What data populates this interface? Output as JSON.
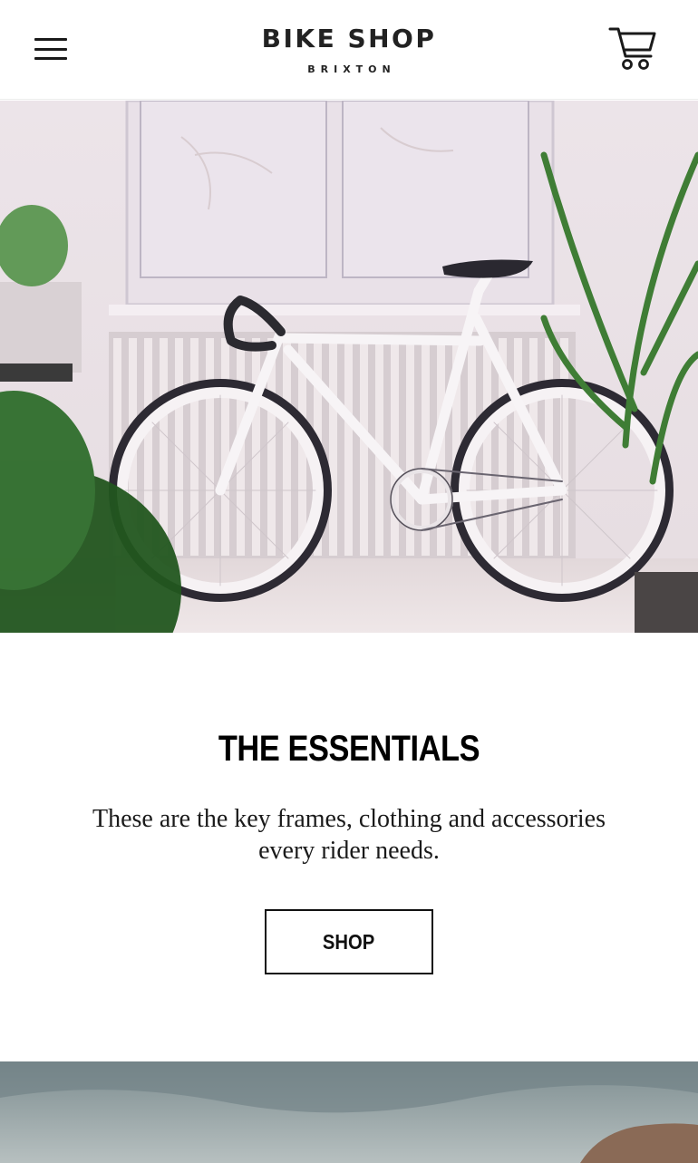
{
  "header": {
    "logo_title": "BIKE SHOP",
    "logo_subtitle": "BRIXTON",
    "menu_icon": "hamburger-menu-icon",
    "cart_icon": "shopping-cart-icon"
  },
  "hero": {
    "image": "white-fixie-bicycle-photo"
  },
  "essentials": {
    "title": "THE ESSENTIALS",
    "description": "These are the key frames, clothing and accessories every rider needs.",
    "button_label": "SHOP"
  },
  "colors": {
    "text": "#111111",
    "background": "#ffffff",
    "border": "#111111"
  }
}
